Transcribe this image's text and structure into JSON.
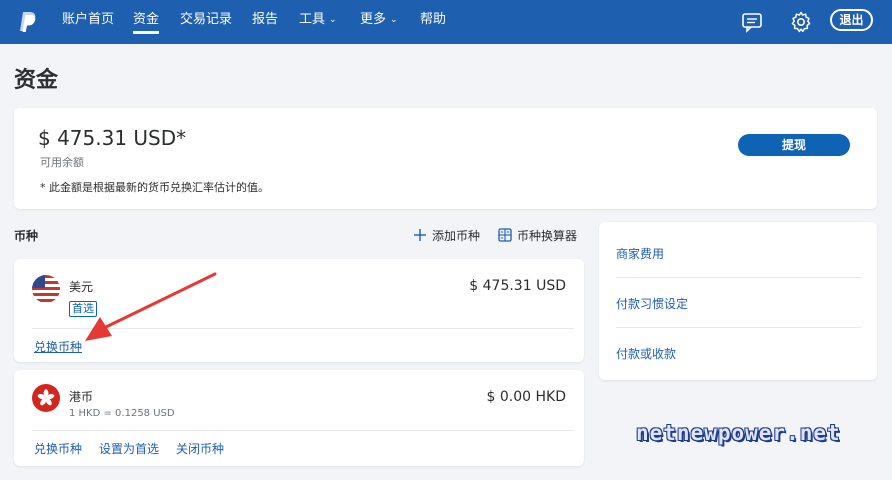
{
  "nav": {
    "items": [
      {
        "label": "账户首页",
        "active": false,
        "caret": false
      },
      {
        "label": "资金",
        "active": true,
        "caret": false
      },
      {
        "label": "交易记录",
        "active": false,
        "caret": false
      },
      {
        "label": "报告",
        "active": false,
        "caret": false
      },
      {
        "label": "工具",
        "active": false,
        "caret": true
      },
      {
        "label": "更多",
        "active": false,
        "caret": true
      },
      {
        "label": "帮助",
        "active": false,
        "caret": false
      }
    ],
    "logout_label": "退出",
    "icons": [
      "paypal-logo",
      "message-icon",
      "gear-icon"
    ]
  },
  "page": {
    "title": "资金"
  },
  "balance": {
    "amount": "$ 475.31 USD*",
    "sub_label": "可用余额",
    "note": "* 此金额是根据最新的货币兑换汇率估计的值。",
    "withdraw_label": "提现"
  },
  "currencies": {
    "section_label": "币种",
    "add_label": "添加币种",
    "converter_label": "币种换算器",
    "usd": {
      "name": "美元",
      "badge": "首选",
      "amount": "$ 475.31 USD",
      "convert_label": "兑换币种"
    },
    "hkd": {
      "name": "港币",
      "rate": "1 HKD = 0.1258 USD",
      "amount": "$ 0.00 HKD",
      "convert_label": "兑换币种",
      "set_primary_label": "设置为首选",
      "close_label": "关闭币种"
    }
  },
  "side": {
    "links": [
      "商家费用",
      "付款习惯设定",
      "付款或收款"
    ]
  },
  "watermark": "netnewpower.net",
  "colors": {
    "nav_bg": "#1f5faf",
    "button": "#0e63b4",
    "link": "#1d5fab",
    "arrow": "#e53935"
  }
}
